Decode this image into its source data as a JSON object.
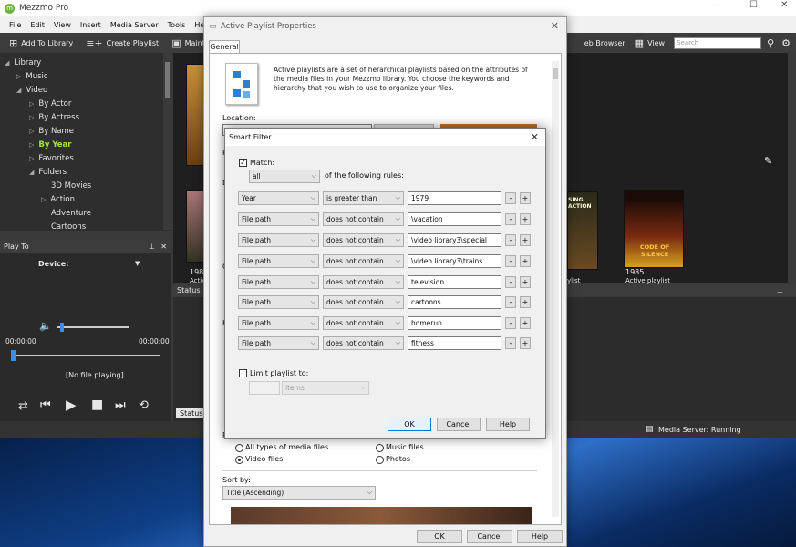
{
  "app": {
    "title": "Mezzmo Pro",
    "window_controls": {
      "minimize": "—",
      "maximize": "☐",
      "close": "✕"
    },
    "menu": [
      "File",
      "Edit",
      "View",
      "Insert",
      "Media Server",
      "Tools",
      "Help"
    ],
    "toolbar": {
      "add_to_library": "Add To Library",
      "create_playlist": "Create Playlist",
      "maintain": "Maintain",
      "web_browser": "eb Browser",
      "view": "View",
      "search_placeholder": "Search"
    }
  },
  "tree": {
    "items": [
      {
        "label": "Library",
        "arrow": "◢"
      },
      {
        "label": "Music",
        "arrow": "▷"
      },
      {
        "label": "Video",
        "arrow": "◢"
      },
      {
        "label": "By Actor",
        "arrow": "▷"
      },
      {
        "label": "By Actress",
        "arrow": "▷"
      },
      {
        "label": "By Name",
        "arrow": "▷"
      },
      {
        "label": "By Year",
        "arrow": "▷"
      },
      {
        "label": "Favorites",
        "arrow": "▷"
      },
      {
        "label": "Folders",
        "arrow": "◢"
      },
      {
        "label": "3D Movies",
        "arrow": ""
      },
      {
        "label": "Action",
        "arrow": "▷"
      },
      {
        "label": "Adventure",
        "arrow": ""
      },
      {
        "label": "Cartoons",
        "arrow": ""
      }
    ]
  },
  "play_to": {
    "header": "Play To",
    "device_label": "Device:",
    "time_start": "00:00:00",
    "time_end": "00:00:00",
    "now_playing": "[No file playing]",
    "volume_level": 0.05,
    "seek_level": 0.0
  },
  "content": {
    "left_year": "1980",
    "left_sub": "Activ",
    "right_year": "1985",
    "right_sub": "Active playlist",
    "mid_sub": "ylist",
    "poster_right_text": "CODE OF SILENCE",
    "poster_mid_text": "SING ACTION"
  },
  "status": {
    "header": "Status",
    "tab": "Status",
    "server": "Media Server: Running"
  },
  "props": {
    "title": "Active Playlist Properties",
    "tab": "General",
    "description": "Active playlists are a set of herarchical playlists based on the attributes of the media files in your Mezzmo library. You choose the keywords and hierarchy that you wish to use to organize your files.",
    "location_label": "Location:",
    "partial_labels": [
      "P",
      "D",
      "C",
      "K",
      "R"
    ],
    "radios": [
      {
        "label": "All types of media files",
        "on": false
      },
      {
        "label": "Music files",
        "on": false
      },
      {
        "label": "Video files",
        "on": true
      },
      {
        "label": "Photos",
        "on": false
      }
    ],
    "sort_label": "Sort by:",
    "sort_value": "Title (Ascending)",
    "ok": "OK",
    "cancel": "Cancel",
    "help": "Help"
  },
  "smart_filter": {
    "title": "Smart Filter",
    "match_label": "Match:",
    "match_value": "all",
    "rules_suffix": "of the following rules:",
    "rules": [
      {
        "field": "Year",
        "op": "is greater than",
        "value": "1979"
      },
      {
        "field": "File path",
        "op": "does not contain",
        "value": "\\vacation"
      },
      {
        "field": "File path",
        "op": "does not contain",
        "value": "\\video library3\\special"
      },
      {
        "field": "File path",
        "op": "does not contain",
        "value": "\\video library3\\trains"
      },
      {
        "field": "File path",
        "op": "does not contain",
        "value": "television"
      },
      {
        "field": "File path",
        "op": "does not contain",
        "value": "cartoons"
      },
      {
        "field": "File path",
        "op": "does not contain",
        "value": "homerun"
      },
      {
        "field": "File path",
        "op": "does not contain",
        "value": "fitness"
      }
    ],
    "minus": "-",
    "plus": "+",
    "limit_label": "Limit playlist to:",
    "limit_unit": "items",
    "ok": "OK",
    "cancel": "Cancel",
    "help": "Help"
  }
}
